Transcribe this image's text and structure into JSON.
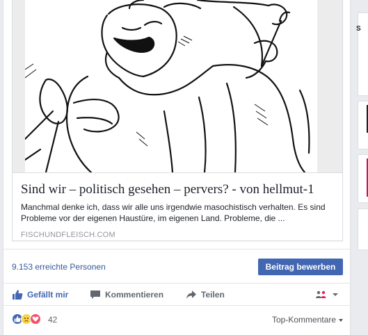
{
  "post": {
    "link_title": "Sind wir – politisch gesehen – pervers? - von hellmut-1",
    "link_description": "Manchmal denke ich, dass wir alle uns irgendwie masochistisch verhalten. Es sind Probleme vor der eigenen Haustüre, im eigenen Land. Probleme, die ...",
    "link_domain": "FISCHUNDFLEISCH.COM"
  },
  "insights": {
    "reach_text": "9.153 erreichte Personen",
    "boost_label": "Beitrag bewerben"
  },
  "actions": {
    "like_label": "Gefällt mir",
    "comment_label": "Kommentieren",
    "share_label": "Teilen"
  },
  "reactions": {
    "count": "42",
    "types": [
      "like",
      "sad",
      "love"
    ],
    "sort_label": "Top-Kommentare"
  },
  "right_sidebar": {
    "letter": "S"
  },
  "colors": {
    "link_blue": "#365899",
    "button_blue": "#4267b2",
    "like_blue": "#4267b2",
    "love_red": "#f25268",
    "sad_yellow": "#f7d54a"
  }
}
